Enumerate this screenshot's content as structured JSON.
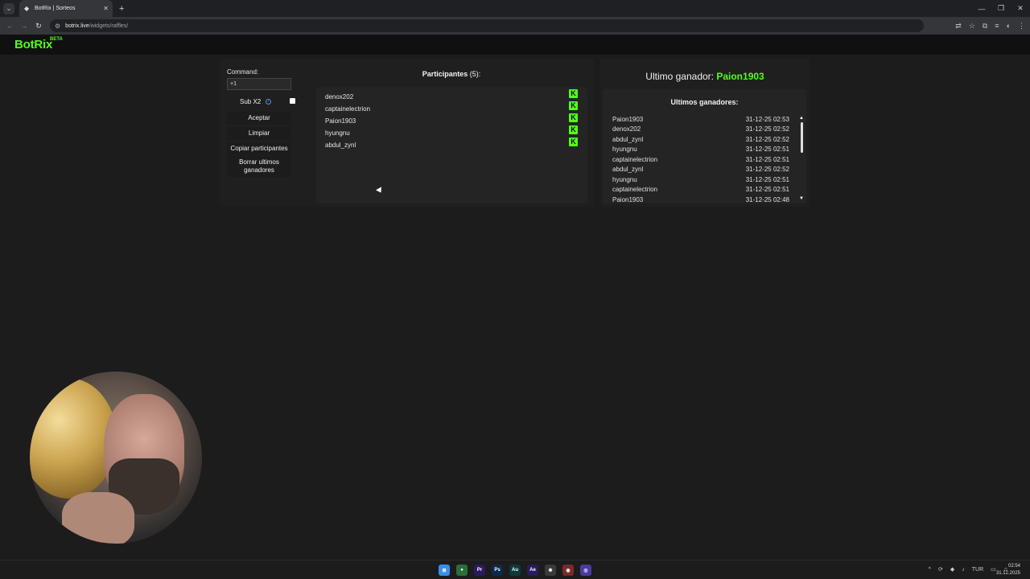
{
  "browser": {
    "tab_title": "BotRix | Sorteos",
    "url_site": "botrix.live",
    "url_path": "/widgets/raffles/"
  },
  "site": {
    "logo": "BotRix",
    "beta": "BETA"
  },
  "controls": {
    "command_label": "Command:",
    "command_value": "+1",
    "sub_label": "Sub X2",
    "accept_label": "Aceptar",
    "clear_label": "Limpiar",
    "copy_label": "Copiar participantes",
    "delete_label": "Borrar ultimos ganadores"
  },
  "participants": {
    "title": "Participantes",
    "count": "(5):",
    "items": [
      "denox202",
      "captainelectrion",
      "Paion1903",
      "hyungnu",
      "abdul_zynl"
    ]
  },
  "winner": {
    "label": "Ultimo ganador:",
    "name": "Paion1903"
  },
  "winners": {
    "title": "Ultimos ganadores:",
    "items": [
      {
        "name": "Paion1903",
        "date": "31-12-25 02:53"
      },
      {
        "name": "denox202",
        "date": "31-12-25 02:52"
      },
      {
        "name": "abdul_zynl",
        "date": "31-12-25 02:52"
      },
      {
        "name": "hyungnu",
        "date": "31-12-25 02:51"
      },
      {
        "name": "captainelectrion",
        "date": "31-12-25 02:51"
      },
      {
        "name": "abdul_zynl",
        "date": "31-12-25 02:52"
      },
      {
        "name": "hyungnu",
        "date": "31-12-25 02:51"
      },
      {
        "name": "captainelectrion",
        "date": "31-12-25 02:51"
      },
      {
        "name": "Paion1903",
        "date": "31-12-25 02:48"
      }
    ]
  },
  "taskbar": {
    "lang": "TUR",
    "time": "02:54",
    "date": "31.12.2025"
  },
  "colors": {
    "accent": "#53fc18",
    "background": "#1c1c1c"
  }
}
